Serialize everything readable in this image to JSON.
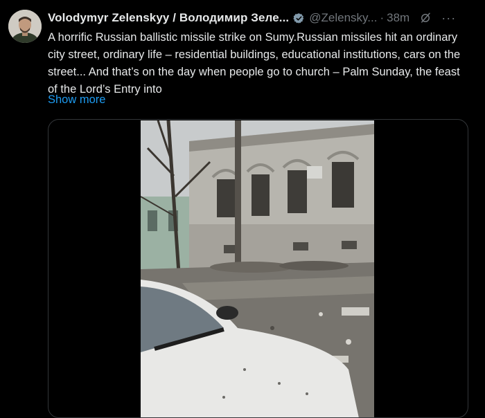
{
  "author": {
    "name": "Volodymyr Zelenskyy / Володимир Зеле...",
    "handle": "@Zelensky...",
    "time": "38m"
  },
  "icons": {
    "verified": "verified-badge-icon",
    "grok": "grok-icon",
    "more": "more-options-icon"
  },
  "text": "A horrific Russian ballistic missile strike on Sumy.Russian missiles hit an ordinary city street, ordinary life – residential buildings, educational institutions, cars on the street... And that’s on the day when people go to church – Palm Sunday, the feast of the Lord’s Entry into",
  "show_more": "Show more",
  "colors": {
    "background": "#000000",
    "text": "#e7e9ea",
    "secondary": "#71767b",
    "link": "#1d9bf0"
  }
}
